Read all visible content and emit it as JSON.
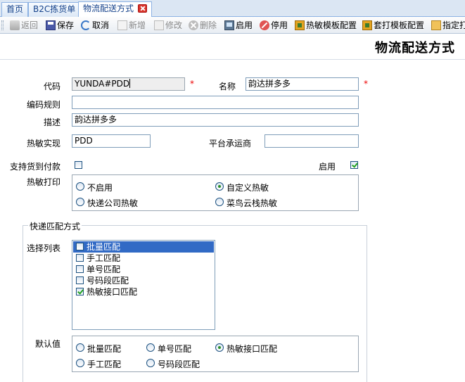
{
  "tabs": [
    {
      "label": "首页"
    },
    {
      "label": "B2C拣货单"
    },
    {
      "label": "物流配送方式"
    }
  ],
  "toolbar": {
    "back": "返回",
    "save": "保存",
    "cancel": "取消",
    "new": "新增",
    "edit": "修改",
    "delete": "删除",
    "enable": "启用",
    "disable": "停用",
    "thermal_template": "热敏模板配置",
    "overlay_template": "套打模板配置",
    "assign_print": "指定打"
  },
  "page_title": "物流配送方式",
  "form": {
    "code_label": "代码",
    "code_value": "YUNDA#PDD",
    "name_label": "名称",
    "name_value": "韵达拼多多",
    "required_mark": "*",
    "rule_label": "编码规则",
    "rule_value": "",
    "desc_label": "描述",
    "desc_value": "韵达拼多多",
    "thermal_impl_label": "热敏实现",
    "thermal_impl_value": "PDD",
    "platform_carrier_label": "平台承运商",
    "platform_carrier_value": "",
    "cod_label": "支持货到付款",
    "cod_checked": false,
    "enabled_label": "启用",
    "enabled_checked": true,
    "thermal_print_label": "热敏打印",
    "thermal_print_options": [
      "不启用",
      "自定义热敏",
      "快递公司热敏",
      "菜鸟云栈热敏"
    ],
    "thermal_print_selected": "自定义热敏",
    "match_group_label": "快递匹配方式",
    "select_list_label": "选择列表",
    "select_list_items": [
      {
        "label": "批量匹配",
        "checked": false,
        "selected": true
      },
      {
        "label": "手工匹配",
        "checked": false,
        "selected": false
      },
      {
        "label": "单号匹配",
        "checked": false,
        "selected": false
      },
      {
        "label": "号码段匹配",
        "checked": false,
        "selected": false
      },
      {
        "label": "热敏接口匹配",
        "checked": true,
        "selected": false
      }
    ],
    "default_label": "默认值",
    "default_options": [
      "批量匹配",
      "单号匹配",
      "热敏接口匹配",
      "手工匹配",
      "号码段匹配"
    ],
    "default_selected": "热敏接口匹配"
  }
}
